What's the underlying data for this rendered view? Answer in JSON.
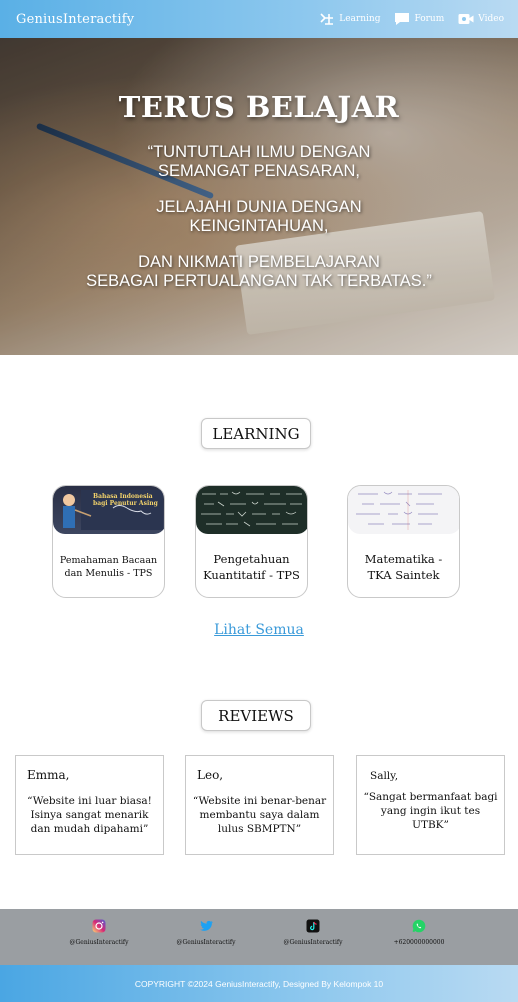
{
  "nav": {
    "brand": "GeniusInteractify",
    "links": [
      {
        "label": "Learning",
        "icon": "learning-icon"
      },
      {
        "label": "Forum",
        "icon": "chat-bubble-icon"
      },
      {
        "label": "Video",
        "icon": "video-camera-icon"
      }
    ]
  },
  "hero": {
    "title": "TERUS BELAJAR",
    "lines": [
      "“TUNTUTLAH ILMU DENGAN",
      "SEMANGAT PENASARAN,",
      "JELAJAHI DUNIA DENGAN",
      "KEINGINTAHUAN,",
      "DAN NIKMATI PEMBELAJARAN",
      "SEBAGAI PERTUALANGAN TAK TERBATAS.”"
    ]
  },
  "learning": {
    "heading": "LEARNING",
    "thumb_caption": [
      "Bahasa Indonesia",
      "bagi Penutur Asing"
    ],
    "cards": [
      {
        "label": "Pemahaman Bacaan dan Menulis - TPS"
      },
      {
        "label": "Pengetahuan Kuantitatif - TPS"
      },
      {
        "label": "Matematika - TKA Saintek"
      }
    ],
    "see_all": "Lihat Semua"
  },
  "reviews": {
    "heading": "REVIEWS",
    "items": [
      {
        "name": "Emma,",
        "quote": "“Website ini luar biasa! Isinya sangat menarik dan mudah dipahami”"
      },
      {
        "name": "Leo,",
        "quote": "“Website ini benar-benar membantu saya dalam lulus SBMPTN”"
      },
      {
        "name": "Sally,",
        "quote": "“Sangat bermanfaat bagi yang ingin ikut tes UTBK”"
      }
    ]
  },
  "social": [
    {
      "icon": "instagram-icon",
      "handle": "@GeniusInteractify",
      "color": "#e1306c"
    },
    {
      "icon": "twitter-icon",
      "handle": "@GeniusInteractify",
      "color": "#1da1f2"
    },
    {
      "icon": "tiktok-icon",
      "handle": "@GeniusInteractify",
      "color": "#111111"
    },
    {
      "icon": "whatsapp-icon",
      "handle": "+620000000000",
      "color": "#25d366"
    }
  ],
  "footer": {
    "copyright": "COPYRIGHT ©2024 GeniusInteractify, Designed By Kelompok 10"
  },
  "colors": {
    "nav_gradient_start": "#5ab0e6",
    "link_blue": "#3a9ad9",
    "social_bar": "#9a9ea2"
  }
}
